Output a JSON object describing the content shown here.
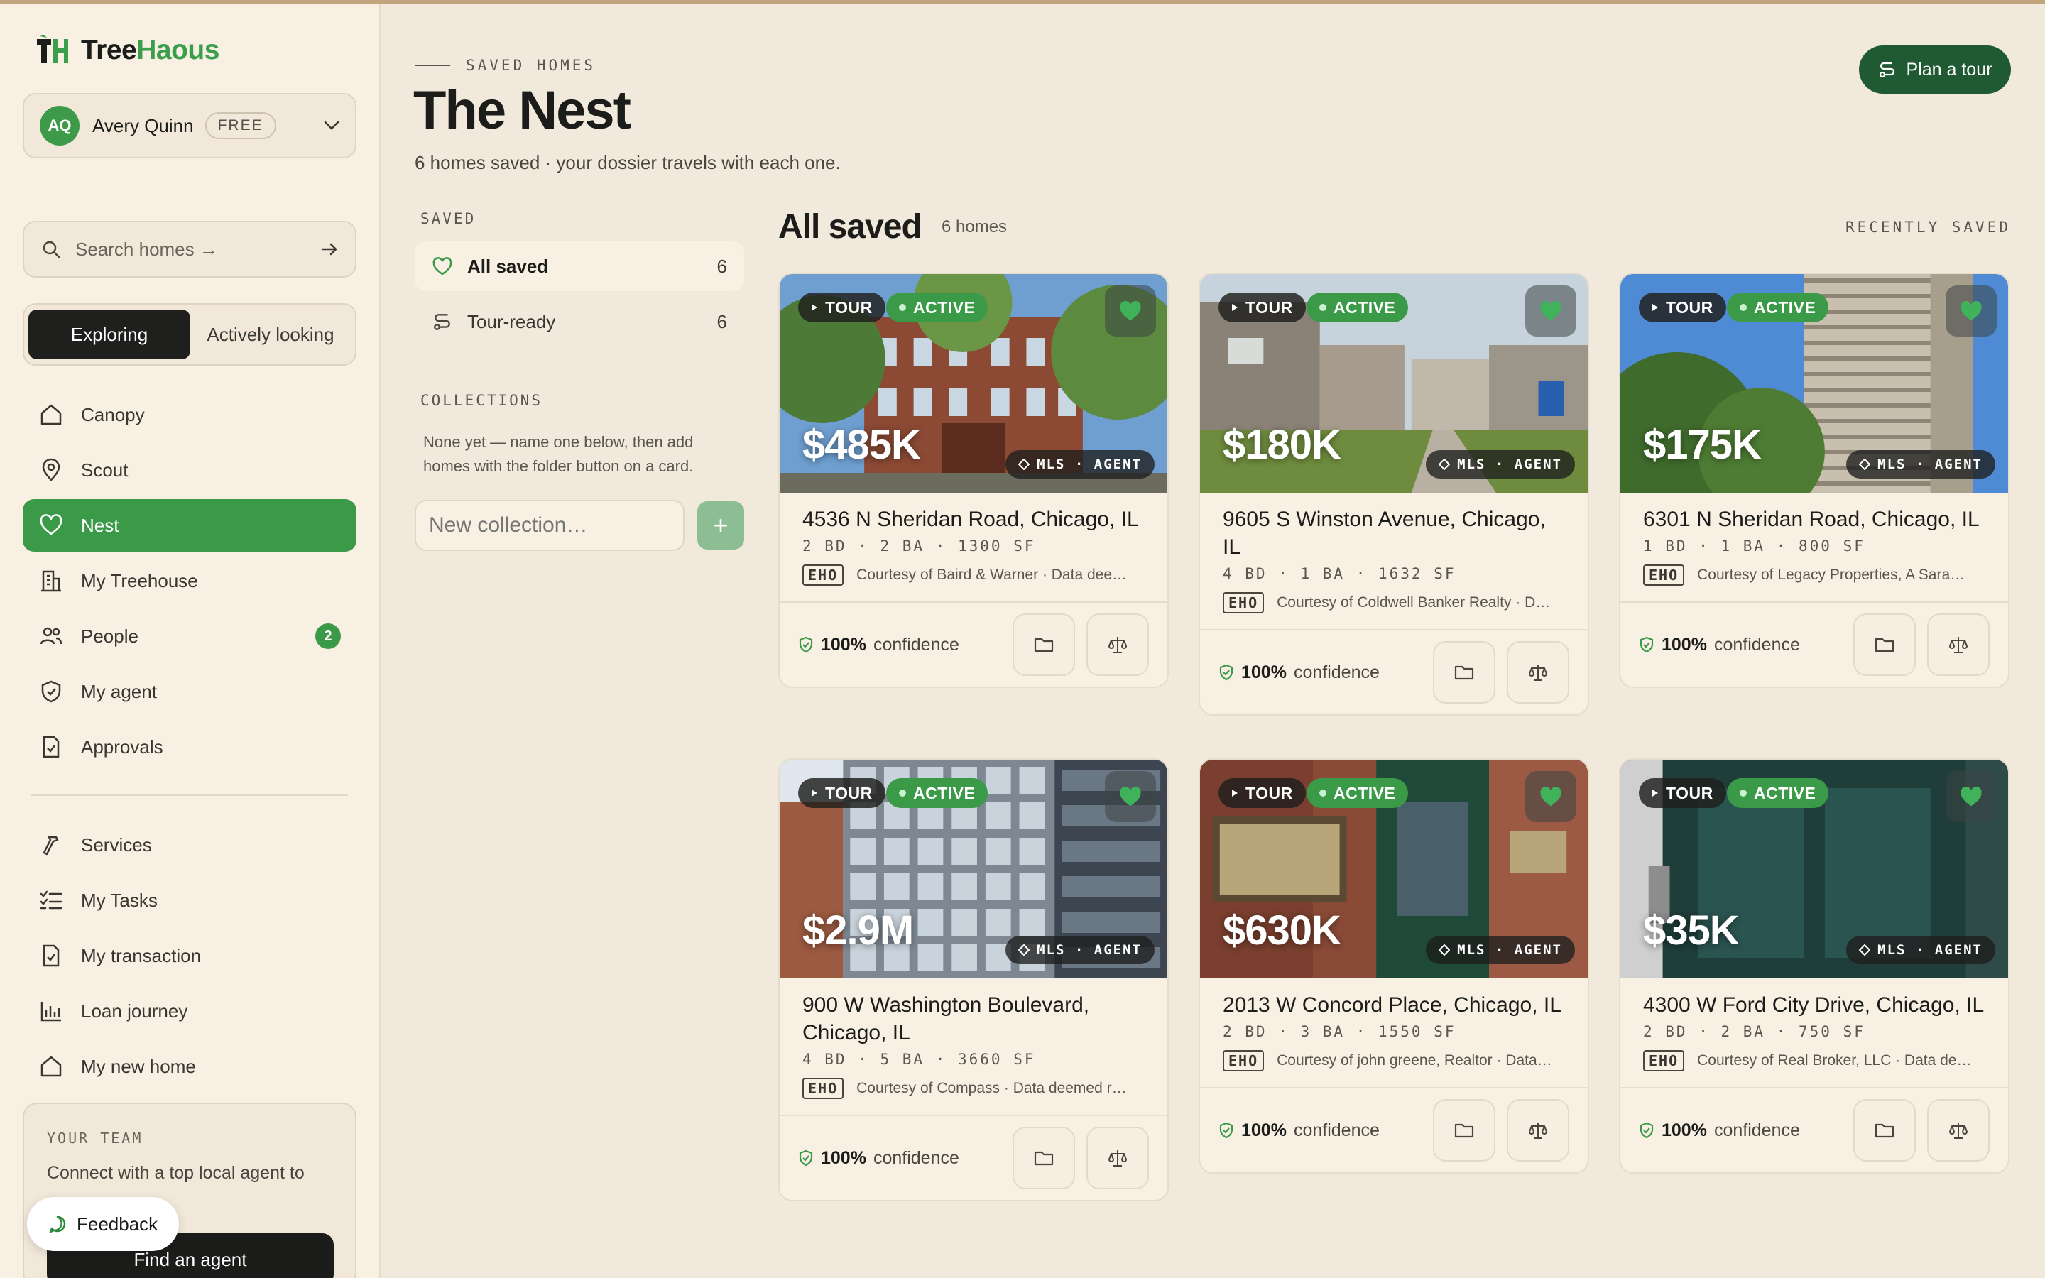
{
  "app": {
    "name_part1": "Tree",
    "name_part2": "Haous"
  },
  "user": {
    "initials": "AQ",
    "name": "Avery Quinn",
    "plan": "FREE"
  },
  "search": {
    "placeholder": "Search homes →"
  },
  "mode": {
    "active": "Exploring",
    "inactive": "Actively looking"
  },
  "nav": {
    "primary": [
      {
        "label": "Canopy",
        "icon": "home-icon"
      },
      {
        "label": "Scout",
        "icon": "map-pin-icon"
      },
      {
        "label": "Nest",
        "icon": "heart-icon",
        "active": true
      },
      {
        "label": "My Treehouse",
        "icon": "building-icon"
      },
      {
        "label": "People",
        "icon": "people-icon",
        "badge": "2"
      },
      {
        "label": "My agent",
        "icon": "shield-icon"
      },
      {
        "label": "Approvals",
        "icon": "document-check-icon"
      }
    ],
    "secondary": [
      {
        "label": "Services",
        "icon": "hammer-icon"
      },
      {
        "label": "My Tasks",
        "icon": "checklist-icon"
      },
      {
        "label": "My transaction",
        "icon": "document-check-icon"
      },
      {
        "label": "Loan journey",
        "icon": "bar-chart-icon"
      },
      {
        "label": "My new home",
        "icon": "home-icon"
      }
    ]
  },
  "team": {
    "label": "YOUR TEAM",
    "text": "Connect with a top local agent to",
    "button": "Find an agent"
  },
  "feedback": {
    "label": "Feedback"
  },
  "header": {
    "eyebrow": "SAVED HOMES",
    "title": "The Nest",
    "subtitle": "6 homes saved · your dossier travels with each one.",
    "tour_button": "Plan a tour"
  },
  "lists": {
    "saved_label": "SAVED",
    "items": [
      {
        "label": "All saved",
        "count": "6"
      },
      {
        "label": "Tour-ready",
        "count": "6"
      }
    ],
    "collections_label": "COLLECTIONS",
    "collections_empty": "None yet — name one below, then add homes with the folder button on a card.",
    "new_placeholder": "New collection…",
    "add_label": "+"
  },
  "grid": {
    "title": "All saved",
    "count": "6 homes",
    "sort": "RECENTLY SAVED"
  },
  "badges": {
    "tour": "TOUR",
    "active": "ACTIVE",
    "mls": "MLS · AGENT",
    "eho": "EHO",
    "confidence_value": "100%",
    "confidence_label": "confidence"
  },
  "colors": {
    "accent_green": "#3a9a48",
    "dark_green": "#1f5a33",
    "background": "#f1e9db"
  },
  "homes": [
    {
      "price": "$485K",
      "address": "4536 N Sheridan Road, Chicago, IL",
      "specs": "2 BD · 2 BA · 1300 SF",
      "courtesy": "Courtesy of Baird & Warner · Data deemed reliable but not guaranteed"
    },
    {
      "price": "$180K",
      "address": "9605 S Winston Avenue, Chicago, IL",
      "specs": "4 BD · 1 BA · 1632 SF",
      "courtesy": "Courtesy of Coldwell Banker Realty · Data deemed reliable"
    },
    {
      "price": "$175K",
      "address": "6301 N Sheridan Road, Chicago, IL",
      "specs": "1 BD · 1 BA · 800 SF",
      "courtesy": "Courtesy of Legacy Properties, A Sarah Leonard Company"
    },
    {
      "price": "$2.9M",
      "address": "900 W Washington Boulevard, Chicago, IL",
      "specs": "4 BD · 5 BA · 3660 SF",
      "courtesy": "Courtesy of Compass · Data deemed reliable"
    },
    {
      "price": "$630K",
      "address": "2013 W Concord Place, Chicago, IL",
      "specs": "2 BD · 3 BA · 1550 SF",
      "courtesy": "Courtesy of john greene, Realtor · Data deemed reliable"
    },
    {
      "price": "$35K",
      "address": "4300 W Ford City Drive, Chicago, IL",
      "specs": "2 BD · 2 BA · 750 SF",
      "courtesy": "Courtesy of Real Broker, LLC · Data deemed reliable"
    }
  ]
}
